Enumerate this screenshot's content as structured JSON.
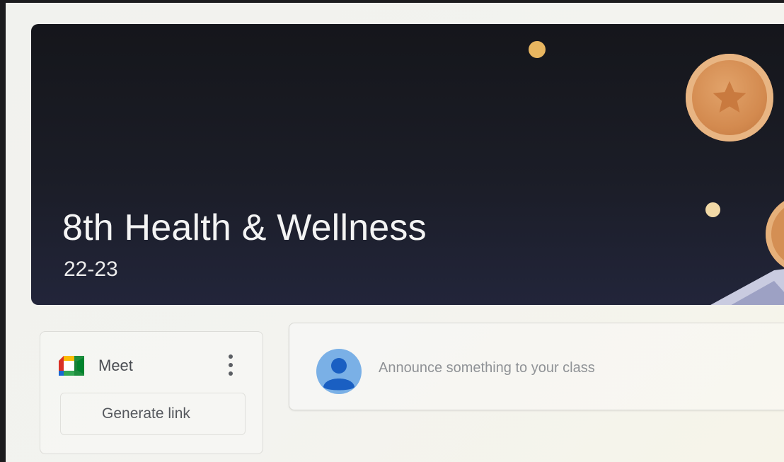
{
  "class_banner": {
    "title": "8th Health & Wellness",
    "section": "22-23",
    "background_color": "#1b1d27",
    "accent_color": "#d38a4f"
  },
  "meet": {
    "icon": "google-meet-icon",
    "label": "Meet",
    "more_icon": "more-vert-icon",
    "generate_link_label": "Generate link"
  },
  "stream": {
    "avatar_icon": "account-avatar-icon",
    "announce_placeholder": "Announce something to your class"
  }
}
